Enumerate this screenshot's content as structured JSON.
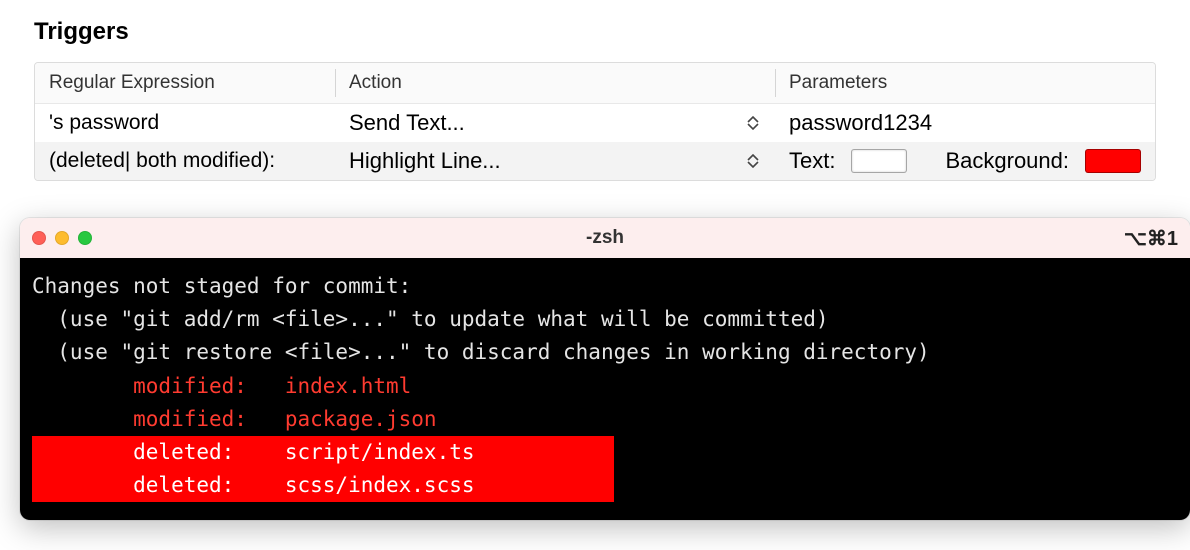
{
  "section": {
    "title": "Triggers"
  },
  "table": {
    "headers": {
      "regex": "Regular Expression",
      "action": "Action",
      "params": "Parameters"
    },
    "rows": [
      {
        "regex": "'s password",
        "action": "Send Text...",
        "params": {
          "type": "text",
          "value": "password1234"
        }
      },
      {
        "regex": "(deleted| both modified):",
        "action": "Highlight Line...",
        "params": {
          "type": "highlight",
          "text_label": "Text:",
          "text_color": "#ffffff",
          "background_label": "Background:",
          "background_color": "#ff0000"
        }
      }
    ]
  },
  "terminal": {
    "title": "-zsh",
    "shortcut": "⌥⌘1",
    "lines": [
      {
        "text": "Changes not staged for commit:",
        "style": "plain"
      },
      {
        "text": "  (use \"git add/rm <file>...\" to update what will be committed)",
        "style": "plain"
      },
      {
        "text": "  (use \"git restore <file>...\" to discard changes in working directory)",
        "style": "plain"
      },
      {
        "text": "        modified:   index.html",
        "style": "red"
      },
      {
        "text": "        modified:   package.json",
        "style": "red"
      },
      {
        "text": "        deleted:    script/index.ts",
        "style": "highlight"
      },
      {
        "text": "        deleted:    scss/index.scss",
        "style": "highlight"
      }
    ]
  }
}
